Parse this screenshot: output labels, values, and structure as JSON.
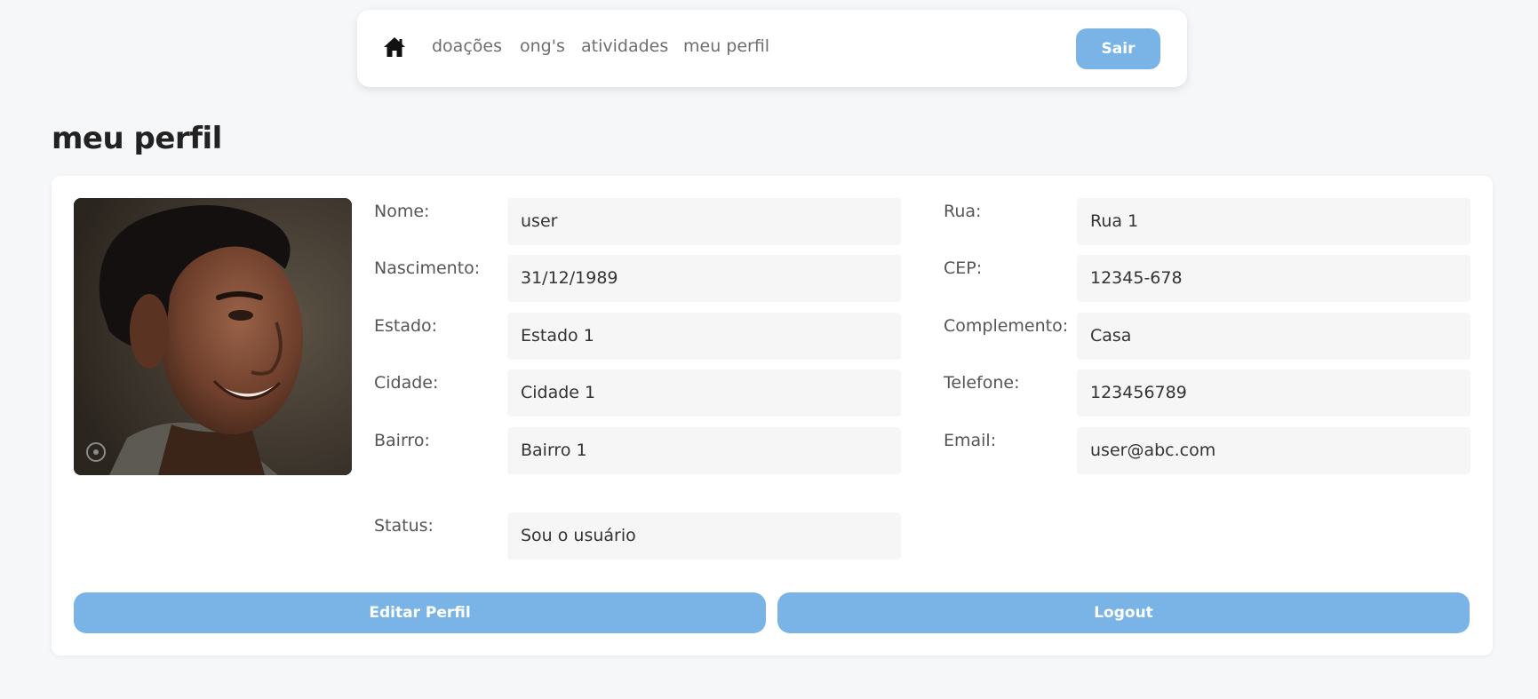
{
  "nav": {
    "home_icon": "home-icon",
    "links": [
      "doações",
      "ong's",
      "atividades",
      "meu perfil"
    ],
    "logout_label": "Sair"
  },
  "page": {
    "title": "meu perfil"
  },
  "profile": {
    "photo": "profile-photo",
    "left_fields": [
      {
        "label": "Nome:",
        "value": "user"
      },
      {
        "label": "Nascimento:",
        "value": "31/12/1989"
      },
      {
        "label": "Estado:",
        "value": "Estado 1"
      },
      {
        "label": "Cidade:",
        "value": "Cidade 1"
      },
      {
        "label": "Bairro:",
        "value": "Bairro 1"
      }
    ],
    "right_fields": [
      {
        "label": "Rua:",
        "value": "Rua 1"
      },
      {
        "label": "CEP:",
        "value": "12345-678"
      },
      {
        "label": "Complemento:",
        "value": "Casa"
      },
      {
        "label": "Telefone:",
        "value": "123456789"
      },
      {
        "label": "Email:",
        "value": "user@abc.com"
      }
    ],
    "status": {
      "label": "Status:",
      "value": "Sou o usuário"
    }
  },
  "actions": {
    "edit_label": "Editar Perfil",
    "logout_label": "Logout"
  },
  "colors": {
    "accent": "#7ab4e6",
    "background": "#f6f7f9",
    "field_bg": "#f6f6f6"
  }
}
